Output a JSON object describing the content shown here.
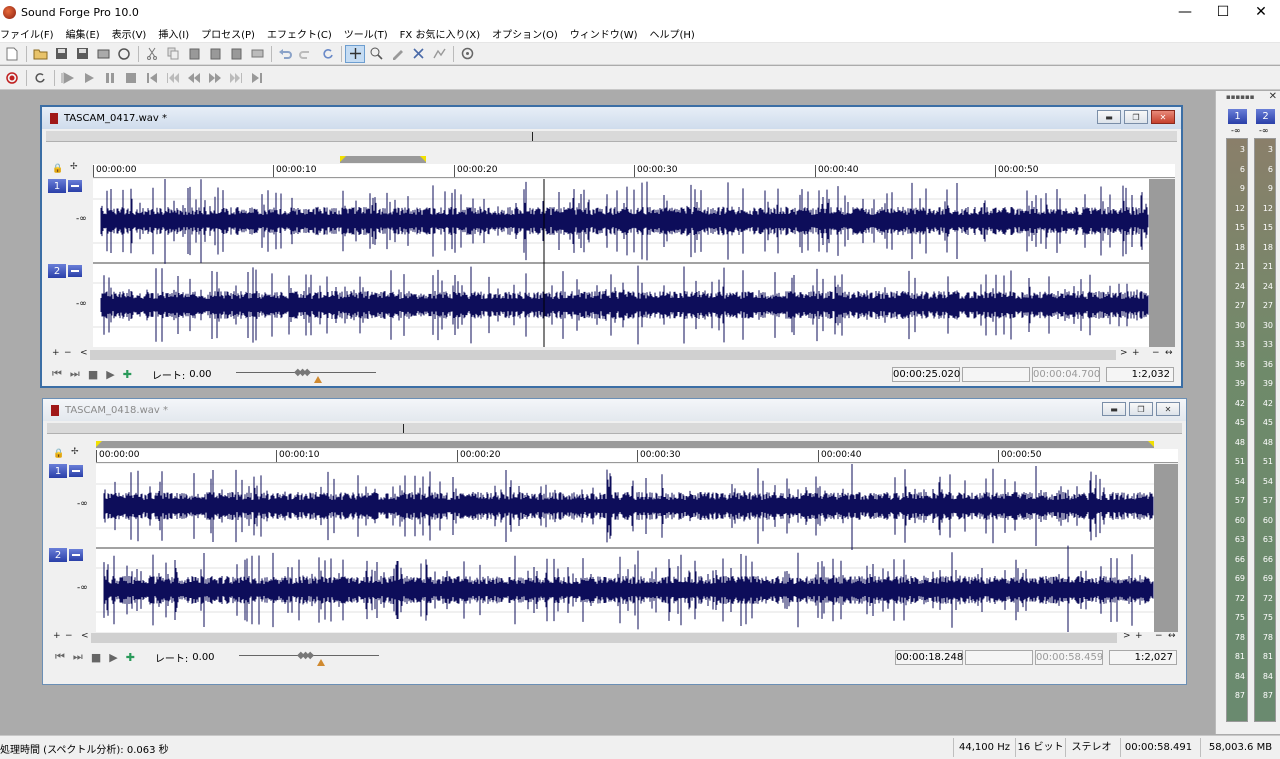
{
  "app": {
    "title": "Sound Forge Pro 10.0"
  },
  "window_controls": {
    "minimize": "—",
    "maximize": "☐",
    "close": "✕"
  },
  "menu": [
    "ファイル(F)",
    "編集(E)",
    "表示(V)",
    "挿入(I)",
    "プロセス(P)",
    "エフェクト(C)",
    "ツール(T)",
    "FX お気に入り(X)",
    "オプション(O)",
    "ウィンドウ(W)",
    "ヘルプ(H)"
  ],
  "toolbar1_icons": [
    "new-icon",
    "open-icon",
    "save-icon",
    "save-all-icon",
    "render-icon",
    "sep",
    "cut-icon",
    "copy-icon",
    "paste-icon",
    "paste-special-icon",
    "mix-icon",
    "crop-icon",
    "sep",
    "undo-icon",
    "redo-icon",
    "repeat-icon",
    "sep",
    "edit-tool-icon",
    "magnify-tool-icon",
    "pencil-tool-icon",
    "event-tool-icon",
    "envelope-tool-icon",
    "sep",
    "plugin-chainer-icon"
  ],
  "toolbar2_icons": [
    "record-icon",
    "sep",
    "loop-icon",
    "sep",
    "play-all-icon",
    "play-icon",
    "pause-icon",
    "stop-icon",
    "go-start-icon",
    "prev-marker-icon",
    "rewind-icon",
    "forward-icon",
    "next-marker-icon",
    "go-end-icon"
  ],
  "windows": [
    {
      "name": "TASCAM_0417.wav *",
      "ticks": [
        "00:00:00",
        "00:00:10",
        "00:00:20",
        "00:00:30",
        "00:00:40",
        "00:00:50"
      ],
      "channels": [
        "1",
        "2"
      ],
      "inf": "-∞",
      "rate_label": "レート:",
      "rate_value": "0.00",
      "cursor_time": "00:00:25.020",
      "selection_blank": "",
      "length_time": "00:00:04.700",
      "zoom": "1:2,032"
    },
    {
      "name": "TASCAM_0418.wav *",
      "ticks": [
        "00:00:00",
        "00:00:10",
        "00:00:20",
        "00:00:30",
        "00:00:40",
        "00:00:50"
      ],
      "channels": [
        "1",
        "2"
      ],
      "inf": "-∞",
      "rate_label": "レート:",
      "rate_value": "0.00",
      "cursor_time": "00:00:18.248",
      "selection_blank": "",
      "length_time": "00:00:58.459",
      "zoom": "1:2,027"
    }
  ],
  "scroll_glyphs": {
    "plus": "+",
    "minus": "−",
    "left": "<",
    "right": ">",
    "fit": "↔"
  },
  "meter": {
    "grip": "▪▪▪▪▪▪",
    "close": "✕",
    "channels": [
      "1",
      "2"
    ],
    "inf": "-∞",
    "scale": [
      "3",
      "6",
      "9",
      "12",
      "15",
      "18",
      "21",
      "24",
      "27",
      "30",
      "33",
      "36",
      "39",
      "42",
      "45",
      "48",
      "51",
      "54",
      "57",
      "60",
      "63",
      "66",
      "69",
      "72",
      "75",
      "78",
      "81",
      "84",
      "87"
    ]
  },
  "status": {
    "left": "処理時間 (スペクトル分析): 0.063 秒",
    "sample_rate": "44,100 Hz",
    "bit_depth": "16 ビット",
    "channels": "ステレオ",
    "length": "00:00:58.491",
    "disk": "58,003.6 MB"
  },
  "colors": {
    "waveform": "#0d0d5a",
    "channel_badge": "#3447b8",
    "active_title": "#cfdcec"
  },
  "waveform_data": {
    "w1_ch1_seed": 17,
    "w1_ch2_seed": 23,
    "w2_ch1_seed": 41,
    "w2_ch2_seed": 53
  }
}
